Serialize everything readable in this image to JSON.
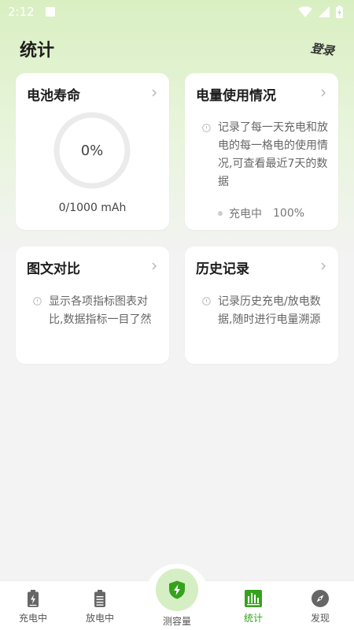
{
  "status_bar": {
    "time": "2:12"
  },
  "header": {
    "title": "统计",
    "login_label": "登录"
  },
  "cards": {
    "battery_life": {
      "title": "电池寿命",
      "percent_text": "0%",
      "percent_value": 0,
      "capacity": "0/1000 mAh"
    },
    "power_usage": {
      "title": "电量使用情况",
      "description": "记录了每一天充电和放电的每一格电的使用情况,可查看最近7天的数据",
      "status_label": "充电中",
      "status_value": "100%"
    },
    "comparison": {
      "title": "图文对比",
      "description": "显示各项指标图表对比,数据指标一目了然"
    },
    "history": {
      "title": "历史记录",
      "description": "记录历史充电/放电数据,随时进行电量溯源"
    }
  },
  "bottom_nav": {
    "items": [
      {
        "label": "充电中",
        "icon": "battery-charging-icon"
      },
      {
        "label": "放电中",
        "icon": "battery-icon"
      },
      {
        "label": "测容量",
        "icon": "shield-bolt-icon"
      },
      {
        "label": "统计",
        "icon": "bar-chart-icon",
        "active": true
      },
      {
        "label": "发现",
        "icon": "compass-icon"
      }
    ]
  },
  "colors": {
    "accent": "#35a21d",
    "ring_track": "#ebebeb",
    "background_top": "#d9efc2"
  }
}
